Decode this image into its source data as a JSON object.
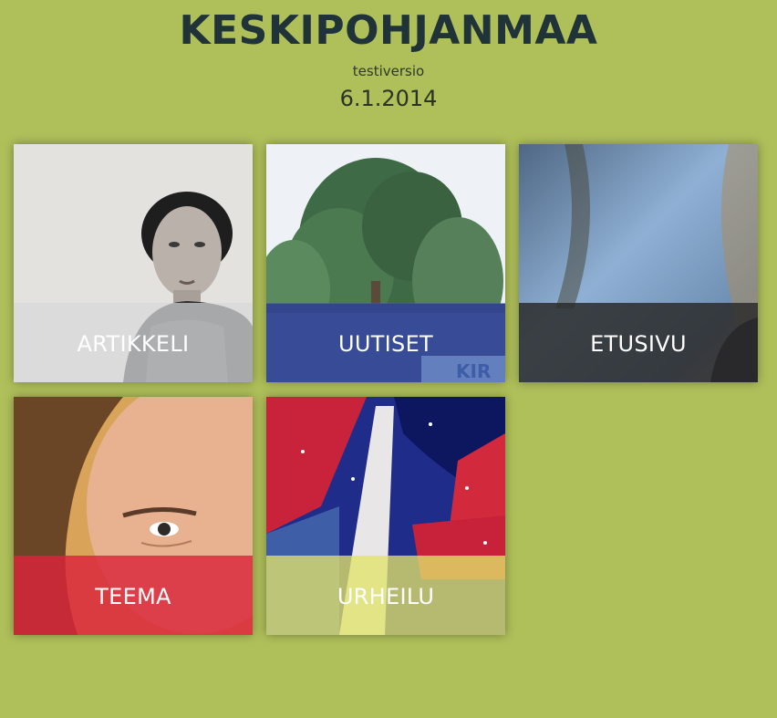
{
  "header": {
    "title": "KESKIPOHJANMAA",
    "subtitle": "testiversio",
    "date": "6.1.2014"
  },
  "tiles": [
    {
      "label": "ARTIKKELI",
      "photo": "portrait-woman-bw",
      "band_color": "#d7d8da"
    },
    {
      "label": "UUTISET",
      "photo": "pine-tree-building",
      "band_color": "#3f55a8"
    },
    {
      "label": "ETUSIVU",
      "photo": "blurred-blue-background",
      "band_color": "#2b2b2b"
    },
    {
      "label": "TEEMA",
      "photo": "portrait-woman-closeup",
      "band_color": "#d9243a"
    },
    {
      "label": "URHEILU",
      "photo": "blurred-flags-snow",
      "band_color": "#e2e36a"
    }
  ]
}
